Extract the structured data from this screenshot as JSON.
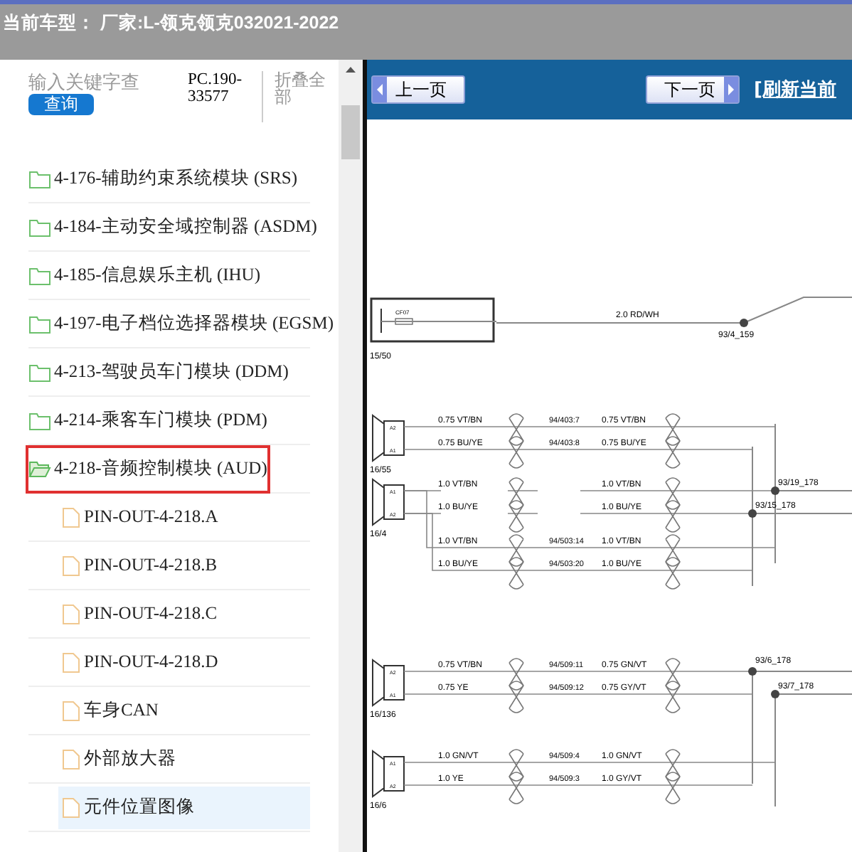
{
  "header": {
    "title": "当前车型：  厂家:L-领克领克032021-2022"
  },
  "sidebar": {
    "search": {
      "placeholder": "输入关键字查"
    },
    "search_button": "查询",
    "code": "PC.190-33577",
    "collapse_all": "折叠全部",
    "tree": [
      {
        "label": "4-176-辅助约束系统模块 (SRS)",
        "expanded": false,
        "marked": false
      },
      {
        "label": "4-184-主动安全域控制器 (ASDM)",
        "expanded": false,
        "marked": false
      },
      {
        "label": "4-185-信息娱乐主机 (IHU)",
        "expanded": false,
        "marked": false
      },
      {
        "label": "4-197-电子档位选择器模块 (EGSM)",
        "expanded": false,
        "marked": false
      },
      {
        "label": "4-213-驾驶员车门模块 (DDM)",
        "expanded": false,
        "marked": false
      },
      {
        "label": "4-214-乘客车门模块 (PDM)",
        "expanded": false,
        "marked": false
      },
      {
        "label": "4-218-音频控制模块 (AUD)",
        "expanded": true,
        "marked": true,
        "children": [
          {
            "label": "PIN-OUT-4-218.A",
            "selected": false
          },
          {
            "label": "PIN-OUT-4-218.B",
            "selected": false
          },
          {
            "label": "PIN-OUT-4-218.C",
            "selected": false
          },
          {
            "label": "PIN-OUT-4-218.D",
            "selected": false
          },
          {
            "label": "车身CAN",
            "selected": false
          },
          {
            "label": "外部放大器",
            "selected": false
          },
          {
            "label": "元件位置图像",
            "selected": true
          }
        ]
      }
    ]
  },
  "toolbar": {
    "prev_button": "上一页",
    "next_button": "下一页",
    "refresh_link": "[刷新当前"
  },
  "wiring_diagram": {
    "fuse": {
      "label": "CF07",
      "connector": "15/50",
      "wire": "2.0 RD/WH"
    },
    "speakers": [
      {
        "connector": "16/55",
        "pins": [
          "A2",
          "A1"
        ],
        "wires": [
          {
            "left": "0.75 VT/BN",
            "inline": "94/403:7",
            "right": "0.75 VT/BN"
          },
          {
            "left": "0.75 BU/YE",
            "inline": "94/403:8",
            "right": "0.75 BU/YE"
          }
        ]
      },
      {
        "connector": "16/4",
        "pins": [
          "A1",
          "A2"
        ],
        "wires": [
          {
            "left": "1.0 VT/BN",
            "right": "1.0 VT/BN"
          },
          {
            "left": "1.0 BU/YE",
            "right": "1.0 BU/YE"
          },
          {
            "left": "1.0 VT/BN",
            "inline": "94/503:14",
            "right": "1.0 VT/BN"
          },
          {
            "left": "1.0 BU/YE",
            "inline": "94/503:20",
            "right": "1.0 BU/YE"
          }
        ]
      },
      {
        "connector": "16/136",
        "pins": [
          "A2",
          "A1"
        ],
        "wires": [
          {
            "left": "0.75 VT/BN",
            "inline": "94/509:11",
            "right": "0.75 GN/VT"
          },
          {
            "left": "0.75 YE",
            "inline": "94/509:12",
            "right": "0.75 GY/VT"
          }
        ]
      },
      {
        "connector": "16/6",
        "pins": [
          "A1",
          "A2"
        ],
        "wires": [
          {
            "left": "1.0 GN/VT",
            "inline": "94/509:4",
            "right": "1.0 GN/VT"
          },
          {
            "left": "1.0 YE",
            "inline": "94/509:3",
            "right": "1.0 GY/VT"
          }
        ]
      }
    ],
    "splices": [
      "93/4_159",
      "93/19_178",
      "93/15_178",
      "93/6_178",
      "93/7_178"
    ]
  }
}
